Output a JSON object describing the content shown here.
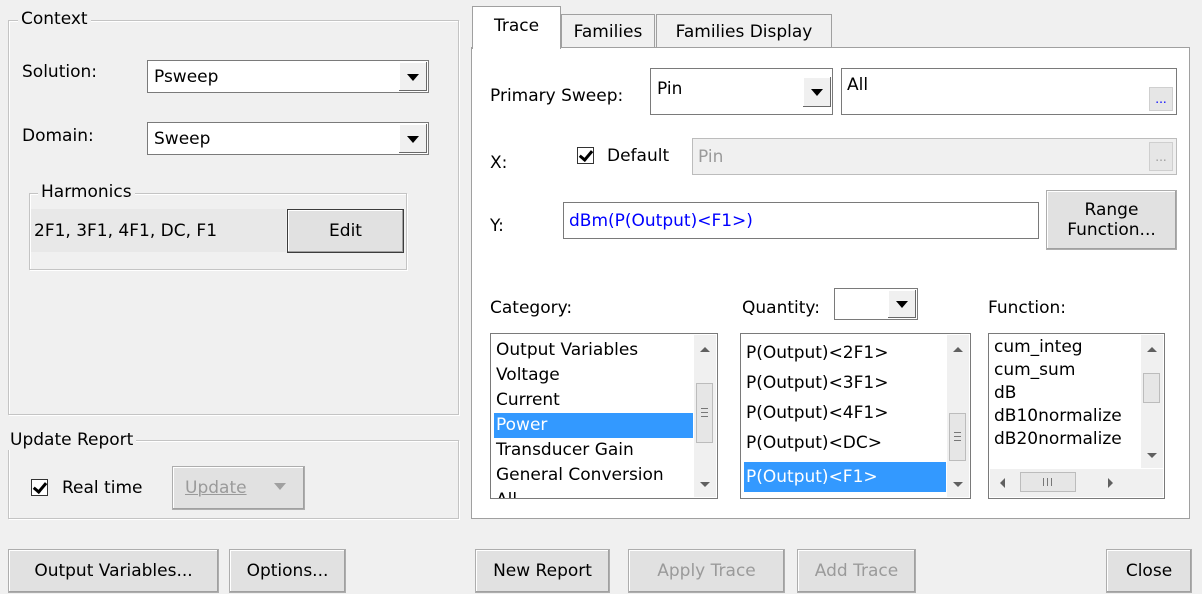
{
  "context": {
    "title": "Context",
    "solution_label": "Solution:",
    "solution_value": "Psweep",
    "domain_label": "Domain:",
    "domain_value": "Sweep",
    "harmonics": {
      "title": "Harmonics",
      "value": "2F1, 3F1, 4F1, DC, F1",
      "edit_label": "Edit"
    }
  },
  "update_report": {
    "title": "Update Report",
    "realtime_label": "Real time",
    "realtime_checked": true,
    "update_label": "Update"
  },
  "tabs": [
    {
      "label": "Trace",
      "active": true
    },
    {
      "label": "Families",
      "active": false
    },
    {
      "label": "Families Display",
      "active": false
    }
  ],
  "trace": {
    "primary_sweep_label": "Primary Sweep:",
    "primary_sweep_value": "Pin",
    "primary_sweep_range": "All",
    "ellipsis": "...",
    "x_label": "X:",
    "x_default_label": "Default",
    "x_default_checked": true,
    "x_value": "Pin",
    "y_label": "Y:",
    "y_value": "dBm(P(Output)<F1>)",
    "range_function_line1": "Range",
    "range_function_line2": "Function...",
    "category_label": "Category:",
    "category_items": [
      "Output Variables",
      "Voltage",
      "Current",
      "Power",
      "Transducer Gain",
      "General Conversion",
      "All"
    ],
    "category_selected": "Power",
    "quantity_label": "Quantity:",
    "quantity_items": [
      "P(Output)<2F1>",
      "P(Output)<3F1>",
      "P(Output)<4F1>",
      "P(Output)<DC>",
      "P(Output)<F1>"
    ],
    "quantity_selected": "P(Output)<F1>",
    "function_label": "Function:",
    "function_items": [
      "cum_integ",
      "cum_sum",
      "dB",
      "dB10normalize",
      "dB20normalize"
    ]
  },
  "buttons": {
    "output_variables": "Output Variables...",
    "options": "Options...",
    "new_report": "New Report",
    "apply_trace": "Apply Trace",
    "add_trace": "Add Trace",
    "close": "Close"
  },
  "colors": {
    "selection": "#3399ff",
    "y_text": "#0000ff",
    "disabled_text": "#9a9a9a"
  }
}
